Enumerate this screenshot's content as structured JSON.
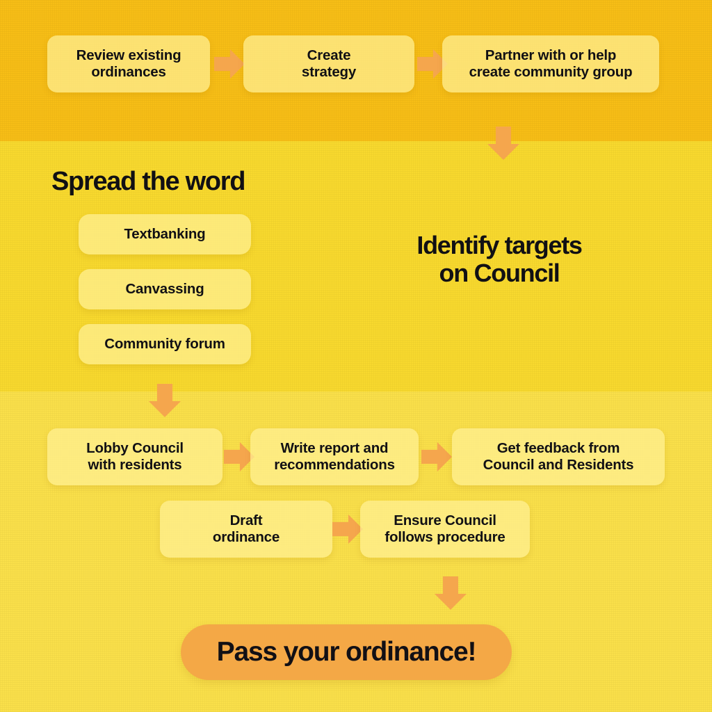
{
  "theme": {
    "band_top_color": "#F7BE16",
    "band_mid_color": "#F8D92E",
    "band_bottom_color": "#FAE04A",
    "box_fill": "#FFF096",
    "arrow_color": "#F5A64D",
    "banner_color": "#F4A846",
    "text_color": "#111014"
  },
  "row_top": {
    "steps": [
      {
        "label": "Review existing\nordinances"
      },
      {
        "label": "Create\nstrategy"
      },
      {
        "label": "Partner with or help\ncreate community group"
      }
    ]
  },
  "section_spread": {
    "heading": "Spread the word",
    "tactics": [
      {
        "label": "Textbanking"
      },
      {
        "label": "Canvassing"
      },
      {
        "label": "Community forum"
      }
    ]
  },
  "section_identify": {
    "heading": "Identify targets\non Council"
  },
  "row_lobby": {
    "steps": [
      {
        "label": "Lobby Council\nwith residents"
      },
      {
        "label": "Write report and\nrecommendations"
      },
      {
        "label": "Get feedback from\nCouncil and Residents"
      }
    ]
  },
  "row_draft": {
    "steps": [
      {
        "label": "Draft\nordinance"
      },
      {
        "label": "Ensure Council\nfollows procedure"
      }
    ]
  },
  "final": {
    "label": "Pass your ordinance!"
  },
  "connectors": {
    "arrow_right_label": "next-step-arrow",
    "arrow_down_label": "flow-down-arrow"
  }
}
